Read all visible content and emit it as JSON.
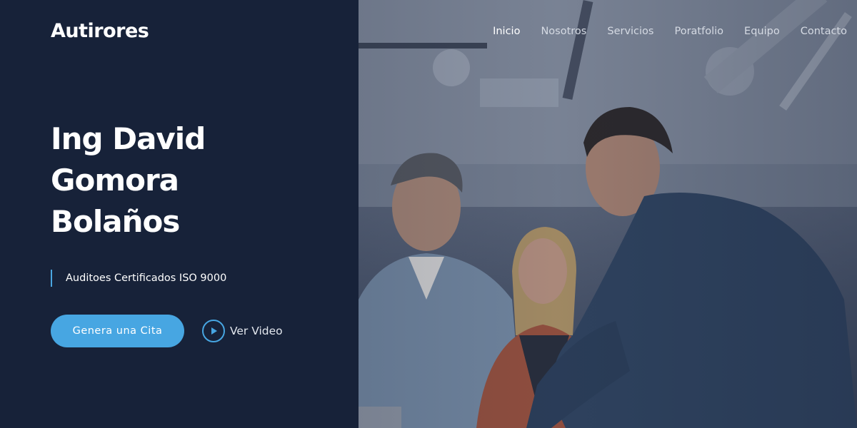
{
  "brand": {
    "logo_text": "Autirores"
  },
  "nav": {
    "items": [
      {
        "label": "Inicio",
        "active": true
      },
      {
        "label": "Nosotros",
        "active": false
      },
      {
        "label": "Servicios",
        "active": false
      },
      {
        "label": "Poratfolio",
        "active": false
      },
      {
        "label": "Equipo",
        "active": false
      },
      {
        "label": "Contacto",
        "active": false
      }
    ]
  },
  "hero": {
    "title_line1": "Ing David",
    "title_line2": "Gomora",
    "title_line3": "Bolaños",
    "subtitle": "Auditoes Certificados ISO 9000",
    "cta_label": "Genera una Cita",
    "video_label": "Ver Video",
    "video_icon": "play-icon"
  },
  "colors": {
    "panel_bg": "#172239",
    "accent": "#47a6e2",
    "text_primary": "#ffffff",
    "nav_text": "#d5dae3"
  }
}
